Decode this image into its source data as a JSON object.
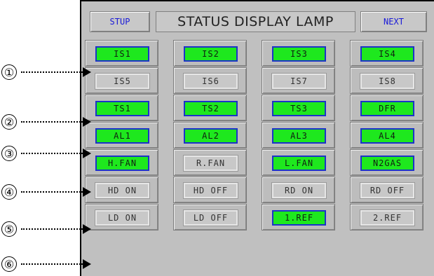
{
  "header": {
    "stup_label": "STUP",
    "title": "STATUS DISPLAY LAMP",
    "next_label": "NEXT"
  },
  "colors": {
    "on": "#1ee81e",
    "on_border": "#1c33c8",
    "off": "#c8c8c8",
    "panel": "#c0c0c0",
    "button_text": "#1a1ad8"
  },
  "rows": [
    [
      {
        "label": "IS1",
        "on": true
      },
      {
        "label": "IS2",
        "on": true
      },
      {
        "label": "IS3",
        "on": true
      },
      {
        "label": "IS4",
        "on": true
      }
    ],
    [
      {
        "label": "IS5",
        "on": false
      },
      {
        "label": "IS6",
        "on": false
      },
      {
        "label": "IS7",
        "on": false
      },
      {
        "label": "IS8",
        "on": false
      }
    ],
    [
      {
        "label": "TS1",
        "on": true
      },
      {
        "label": "TS2",
        "on": true
      },
      {
        "label": "TS3",
        "on": true
      },
      {
        "label": "DFR",
        "on": true
      }
    ],
    [
      {
        "label": "AL1",
        "on": true
      },
      {
        "label": "AL2",
        "on": true
      },
      {
        "label": "AL3",
        "on": true
      },
      {
        "label": "AL4",
        "on": true
      }
    ],
    [
      {
        "label": "H.FAN",
        "on": true
      },
      {
        "label": "R.FAN",
        "on": false
      },
      {
        "label": "L.FAN",
        "on": true
      },
      {
        "label": "N2GAS",
        "on": true
      }
    ],
    [
      {
        "label": "HD ON",
        "on": false
      },
      {
        "label": "HD OFF",
        "on": false
      },
      {
        "label": "RD ON",
        "on": false
      },
      {
        "label": "RD OFF",
        "on": false
      }
    ],
    [
      {
        "label": "LD ON",
        "on": false
      },
      {
        "label": "LD OFF",
        "on": false
      },
      {
        "label": "1.REF",
        "on": true
      },
      {
        "label": "2.REF",
        "on": false
      }
    ]
  ],
  "markers": [
    "①",
    "②",
    "③",
    "④",
    "⑤",
    "⑥"
  ]
}
